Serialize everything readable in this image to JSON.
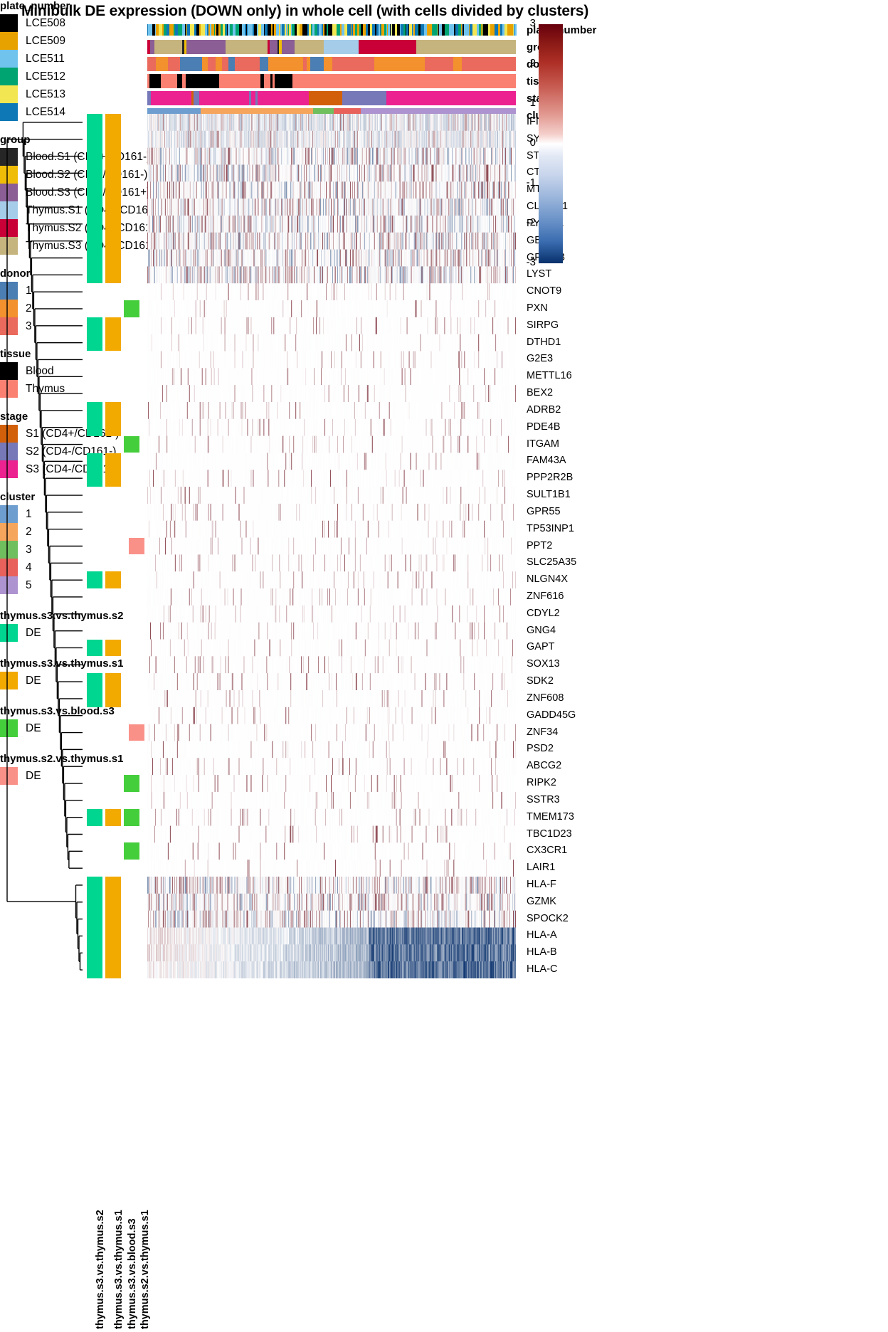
{
  "title": "Minibulk DE expression (DOWN only) in whole cell (with cells divided by clusters)",
  "colorbar": {
    "ticks": [
      "3",
      "2",
      "1",
      "0",
      "-1",
      "-2",
      "-3"
    ],
    "max": 3,
    "min": -3,
    "high_color": "#67000d",
    "mid_color": "#ffffff",
    "low_color": "#08306b"
  },
  "column_annotation_rows": [
    {
      "name": "plate_number",
      "label": "plate_number"
    },
    {
      "name": "group",
      "label": "group"
    },
    {
      "name": "donor",
      "label": "donor"
    },
    {
      "name": "tissue",
      "label": "tissue"
    },
    {
      "name": "stage",
      "label": "stage"
    },
    {
      "name": "cluster",
      "label": "cluster"
    }
  ],
  "legends": [
    {
      "name": "plate_number",
      "title": "plate_number",
      "items": [
        {
          "label": "LCE508",
          "color": "#000000"
        },
        {
          "label": "LCE509",
          "color": "#E8A200"
        },
        {
          "label": "LCE511",
          "color": "#6FC3EC"
        },
        {
          "label": "LCE512",
          "color": "#00A470"
        },
        {
          "label": "LCE513",
          "color": "#F2E752"
        },
        {
          "label": "LCE514",
          "color": "#0E77B5"
        }
      ]
    },
    {
      "name": "group",
      "title": "group",
      "items": [
        {
          "label": "Blood.S1 (CD4+/CD161-)",
          "color": "#262626"
        },
        {
          "label": "Blood.S2 (CD4-/CD161-)",
          "color": "#EFBD08"
        },
        {
          "label": "Blood.S3 (CD4-/CD161+)",
          "color": "#8B5E96"
        },
        {
          "label": "Thymus.S1 (CD4+/CD161-)",
          "color": "#A5CDEA"
        },
        {
          "label": "Thymus.S2 (CD4-/CD161-)",
          "color": "#C90038"
        },
        {
          "label": "Thymus.S3 (CD4-/CD161+)",
          "color": "#C6B47F"
        }
      ]
    },
    {
      "name": "donor",
      "title": "donor",
      "items": [
        {
          "label": "1",
          "color": "#4B7EB3"
        },
        {
          "label": "2",
          "color": "#F2912D"
        },
        {
          "label": "3",
          "color": "#EA6A5D"
        }
      ]
    },
    {
      "name": "tissue",
      "title": "tissue",
      "items": [
        {
          "label": "Blood",
          "color": "#000000"
        },
        {
          "label": "Thymus",
          "color": "#FA8072"
        }
      ]
    },
    {
      "name": "stage",
      "title": "stage",
      "items": [
        {
          "label": "S1 (CD4+/CD161-)",
          "color": "#D2600B"
        },
        {
          "label": "S2 (CD4-/CD161-)",
          "color": "#7678B8"
        },
        {
          "label": "S3 (CD4-/CD161+)",
          "color": "#EC2290"
        }
      ]
    },
    {
      "name": "cluster",
      "title": "cluster",
      "items": [
        {
          "label": "1",
          "color": "#6E9ECF"
        },
        {
          "label": "2",
          "color": "#F6A košt"
        },
        {
          "label": "3",
          "color": "#6FBF5E"
        },
        {
          "label": "4",
          "color": "#E8615B"
        },
        {
          "label": "5",
          "color": "#AD93CF"
        }
      ]
    },
    {
      "name": "thymus-s3-vs-thymus-s2",
      "title": "thymus.s3.vs.thymus.s2",
      "items": [
        {
          "label": "DE",
          "color": "#00D68F"
        }
      ]
    },
    {
      "name": "thymus-s3-vs-thymus-s1",
      "title": "thymus.s3.vs.thymus.s1",
      "items": [
        {
          "label": "DE",
          "color": "#F2A900"
        }
      ]
    },
    {
      "name": "thymus-s3-vs-blood-s3",
      "title": "thymus.s3.vs.blood.s3",
      "items": [
        {
          "label": "DE",
          "color": "#45CE3C"
        }
      ]
    },
    {
      "name": "thymus-s2-vs-thymus-s1",
      "title": "thymus.s2.vs.thymus.s1",
      "items": [
        {
          "label": "DE",
          "color": "#FA9189"
        }
      ]
    }
  ],
  "de_columns": [
    {
      "name": "thymus.s3.vs.thymus.s2",
      "color": "#00D68F"
    },
    {
      "name": "thymus.s3.vs.thymus.s1",
      "color": "#F2A900"
    },
    {
      "name": "thymus.s3.vs.blood.s3",
      "color": "#45CE3C"
    },
    {
      "name": "thymus.s2.vs.thymus.s1",
      "color": "#FA9189"
    }
  ],
  "chart_data": {
    "type": "heatmap",
    "title": "Minibulk DE expression (DOWN only) in whole cell (with cells divided by clusters)",
    "xlabel": "",
    "ylabel": "",
    "zlim": [
      -3,
      3
    ],
    "colorbar_ticks": [
      3,
      2,
      1,
      0,
      -1,
      -2,
      -3
    ],
    "n_columns": 520,
    "row_labels": [
      "IFITM2",
      "SYNE2",
      "STMN1",
      "CTSW",
      "MT2A",
      "CLDND1",
      "PYHIN1",
      "GBP2",
      "GPRIN3",
      "LYST",
      "CNOT9",
      "PXN",
      "SIRPG",
      "DTHD1",
      "G2E3",
      "METTL16",
      "BEX2",
      "ADRB2",
      "PDE4B",
      "ITGAM",
      "FAM43A",
      "PPP2R2B",
      "SULT1B1",
      "GPR55",
      "TP53INP1",
      "PPT2",
      "SLC25A35",
      "NLGN4X",
      "ZNF616",
      "CDYL2",
      "GNG4",
      "GAPT",
      "SOX13",
      "SDK2",
      "ZNF608",
      "GADD45G",
      "ZNF34",
      "PSD2",
      "ABCG2",
      "RIPK2",
      "SSTR3",
      "TMEM173",
      "TBC1D23",
      "CX3CR1",
      "LAIR1",
      "HLA-F",
      "GZMK",
      "SPOCK2",
      "HLA-A",
      "HLA-B",
      "HLA-C"
    ],
    "row_de_flags": {
      "thymus.s3.vs.thymus.s2": [
        1,
        1,
        1,
        1,
        1,
        1,
        1,
        1,
        1,
        1,
        0,
        0,
        1,
        1,
        0,
        0,
        0,
        1,
        1,
        0,
        1,
        1,
        0,
        0,
        0,
        0,
        0,
        1,
        0,
        0,
        0,
        1,
        0,
        1,
        1,
        0,
        0,
        0,
        0,
        0,
        0,
        1,
        0,
        0,
        0,
        1,
        1,
        1,
        1,
        1,
        1
      ],
      "thymus.s3.vs.thymus.s1": [
        1,
        1,
        1,
        1,
        1,
        1,
        1,
        1,
        1,
        1,
        0,
        0,
        1,
        1,
        0,
        0,
        0,
        1,
        1,
        0,
        1,
        1,
        0,
        0,
        0,
        0,
        0,
        1,
        0,
        0,
        0,
        1,
        0,
        1,
        1,
        0,
        0,
        0,
        0,
        0,
        0,
        1,
        0,
        0,
        0,
        1,
        1,
        1,
        1,
        1,
        1
      ],
      "thymus.s3.vs.blood.s3": [
        0,
        0,
        0,
        0,
        0,
        0,
        0,
        0,
        0,
        0,
        0,
        1,
        0,
        0,
        0,
        0,
        0,
        0,
        0,
        1,
        0,
        0,
        0,
        0,
        0,
        0,
        0,
        0,
        0,
        0,
        0,
        0,
        0,
        0,
        0,
        0,
        0,
        0,
        0,
        1,
        0,
        1,
        0,
        1,
        0,
        0,
        0,
        0,
        0,
        0,
        0
      ],
      "thymus.s2.vs.thymus.s1": [
        0,
        0,
        0,
        0,
        0,
        0,
        0,
        0,
        0,
        0,
        0,
        0,
        0,
        0,
        0,
        0,
        0,
        0,
        0,
        0,
        0,
        0,
        0,
        0,
        0,
        1,
        0,
        0,
        0,
        0,
        0,
        0,
        0,
        0,
        0,
        0,
        1,
        0,
        0,
        0,
        0,
        0,
        0,
        0,
        0,
        0,
        0,
        0,
        0,
        0,
        0
      ]
    },
    "row_intensity_profile": [
      {
        "gene": "IFITM2",
        "mean": -0.35,
        "band": "blue"
      },
      {
        "gene": "SYNE2",
        "mean": -0.3,
        "band": "blue"
      },
      {
        "gene": "STMN1",
        "mean": 0.15,
        "band": "mixed"
      },
      {
        "gene": "CTSW",
        "mean": -0.08,
        "band": "mixed"
      },
      {
        "gene": "MT2A",
        "mean": -0.1,
        "band": "mixed"
      },
      {
        "gene": "CLDND1",
        "mean": 0.1,
        "band": "mixed"
      },
      {
        "gene": "PYHIN1",
        "mean": -0.12,
        "band": "mixed"
      },
      {
        "gene": "GBP2",
        "mean": -0.06,
        "band": "mixed"
      },
      {
        "gene": "GPRIN3",
        "mean": -0.08,
        "band": "mixed"
      },
      {
        "gene": "LYST",
        "mean": -0.08,
        "band": "mixed"
      },
      {
        "gene": "CNOT9",
        "mean": 0.02,
        "band": "sparse"
      },
      {
        "gene": "PXN",
        "mean": 0.01,
        "band": "sparse"
      },
      {
        "gene": "SIRPG",
        "mean": 0.02,
        "band": "sparse"
      },
      {
        "gene": "DTHD1",
        "mean": 0.01,
        "band": "sparse"
      },
      {
        "gene": "G2E3",
        "mean": 0.02,
        "band": "sparse"
      },
      {
        "gene": "METTL16",
        "mean": 0.01,
        "band": "sparse"
      },
      {
        "gene": "BEX2",
        "mean": 0.01,
        "band": "sparse"
      },
      {
        "gene": "ADRB2",
        "mean": 0.01,
        "band": "sparse"
      },
      {
        "gene": "PDE4B",
        "mean": 0.01,
        "band": "sparse"
      },
      {
        "gene": "ITGAM",
        "mean": 0.01,
        "band": "sparse"
      },
      {
        "gene": "FAM43A",
        "mean": 0.01,
        "band": "sparse"
      },
      {
        "gene": "PPP2R2B",
        "mean": 0.01,
        "band": "sparse"
      },
      {
        "gene": "SULT1B1",
        "mean": 0.01,
        "band": "sparse"
      },
      {
        "gene": "GPR55",
        "mean": 0.01,
        "band": "sparse"
      },
      {
        "gene": "TP53INP1",
        "mean": 0.01,
        "band": "sparse"
      },
      {
        "gene": "PPT2",
        "mean": 0.01,
        "band": "sparse"
      },
      {
        "gene": "SLC25A35",
        "mean": 0.01,
        "band": "sparse"
      },
      {
        "gene": "NLGN4X",
        "mean": 0.01,
        "band": "sparse"
      },
      {
        "gene": "ZNF616",
        "mean": 0.01,
        "band": "sparse"
      },
      {
        "gene": "CDYL2",
        "mean": 0.01,
        "band": "sparse"
      },
      {
        "gene": "GNG4",
        "mean": 0.01,
        "band": "sparse"
      },
      {
        "gene": "GAPT",
        "mean": 0.01,
        "band": "sparse"
      },
      {
        "gene": "SOX13",
        "mean": 0.01,
        "band": "sparse"
      },
      {
        "gene": "SDK2",
        "mean": 0.01,
        "band": "sparse"
      },
      {
        "gene": "ZNF608",
        "mean": 0.01,
        "band": "sparse"
      },
      {
        "gene": "GADD45G",
        "mean": 0.01,
        "band": "sparse"
      },
      {
        "gene": "ZNF34",
        "mean": 0.01,
        "band": "sparse"
      },
      {
        "gene": "PSD2",
        "mean": 0.005,
        "band": "sparse"
      },
      {
        "gene": "ABCG2",
        "mean": 0.005,
        "band": "sparse"
      },
      {
        "gene": "RIPK2",
        "mean": 0.005,
        "band": "sparse"
      },
      {
        "gene": "SSTR3",
        "mean": 0.005,
        "band": "sparse"
      },
      {
        "gene": "TMEM173",
        "mean": 0.02,
        "band": "sparse"
      },
      {
        "gene": "TBC1D23",
        "mean": 0.01,
        "band": "sparse"
      },
      {
        "gene": "CX3CR1",
        "mean": 0.03,
        "band": "sparse"
      },
      {
        "gene": "LAIR1",
        "mean": 0.02,
        "band": "sparse"
      },
      {
        "gene": "HLA-F",
        "mean": 0.05,
        "band": "mixed"
      },
      {
        "gene": "GZMK",
        "mean": 0.0,
        "band": "mixed"
      },
      {
        "gene": "SPOCK2",
        "mean": -0.05,
        "band": "mixed"
      },
      {
        "gene": "HLA-A",
        "mean": -0.4,
        "band": "strong"
      },
      {
        "gene": "HLA-B",
        "mean": -0.45,
        "band": "strong"
      },
      {
        "gene": "HLA-C",
        "mean": -0.5,
        "band": "strong"
      }
    ]
  }
}
